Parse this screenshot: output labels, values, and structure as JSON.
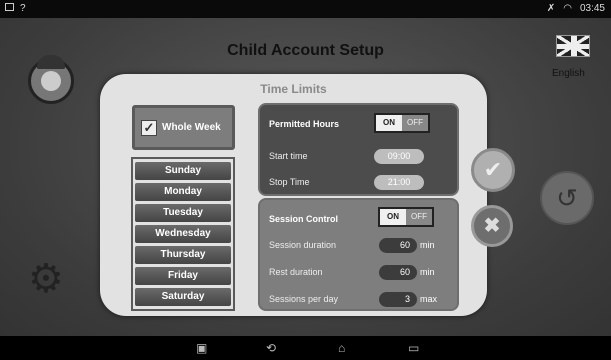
{
  "status_bar": {
    "time": "03:45",
    "left_icons": [
      "gallery-icon",
      "question-icon"
    ],
    "right_icons": [
      "signal-icon",
      "wifi-icon"
    ]
  },
  "app": {
    "title": "Child Account Setup",
    "language": "English"
  },
  "dialog": {
    "title": "Time Limits",
    "whole_week": {
      "label": "Whole Week",
      "checked": true
    },
    "days": [
      "Sunday",
      "Monday",
      "Tuesday",
      "Wednesday",
      "Thursday",
      "Friday",
      "Saturday"
    ],
    "permitted_hours": {
      "label": "Permitted Hours",
      "toggle_on": "ON",
      "toggle_off": "OFF",
      "state": "ON",
      "start_label": "Start time",
      "start_value": "09:00",
      "stop_label": "Stop Time",
      "stop_value": "21:00"
    },
    "session_control": {
      "label": "Session Control",
      "toggle_on": "ON",
      "toggle_off": "OFF",
      "state": "ON",
      "duration_label": "Session duration",
      "duration_value": "60",
      "duration_unit": "min",
      "rest_label": "Rest duration",
      "rest_value": "60",
      "rest_unit": "min",
      "sessions_label": "Sessions per day",
      "sessions_value": "3",
      "sessions_unit": "max"
    }
  },
  "icons": {
    "confirm": "✔",
    "cancel": "✖",
    "back": "↺",
    "check": "✓"
  },
  "nav": {
    "screenshot": "▣",
    "back": "⟲",
    "home": "⌂",
    "recents": "▭"
  }
}
